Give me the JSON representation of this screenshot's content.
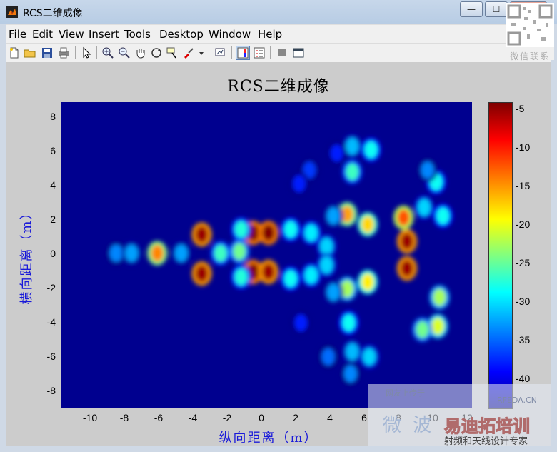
{
  "window": {
    "title": "RCS二维成像",
    "buttons": {
      "minimize": "—",
      "maximize": "☐",
      "close": "✕"
    }
  },
  "menu": [
    "File",
    "Edit",
    "View",
    "Insert",
    "Tools",
    "Desktop",
    "Window",
    "Help"
  ],
  "toolbar": {
    "icons": [
      "new-figure-icon",
      "open-icon",
      "save-icon",
      "print-icon",
      "select-arrow-icon",
      "zoom-in-icon",
      "zoom-out-icon",
      "pan-hand-icon",
      "rotate-3d-icon",
      "data-cursor-icon",
      "brush-icon",
      "link-plot-icon",
      "colorbar-icon",
      "legend-icon",
      "hide-tools-icon",
      "show-tools-icon"
    ]
  },
  "qr_caption": "微信联系",
  "chart_data": {
    "type": "heatmap",
    "title": "RCS二维成像",
    "xlabel": "纵向距离（m）",
    "ylabel": "横向距离（m）",
    "xlim": [
      -12,
      12
    ],
    "ylim": [
      -9,
      9
    ],
    "x_ticks": [
      "-10",
      "-8",
      "-6",
      "-4",
      "-2",
      "0",
      "2",
      "4",
      "6",
      "8",
      "10",
      "12"
    ],
    "y_ticks": [
      "8",
      "6",
      "4",
      "2",
      "0",
      "-2",
      "-4",
      "-6",
      "-8"
    ],
    "colorbar_ticks": [
      "-5",
      "-10",
      "-15",
      "-20",
      "-25",
      "-30",
      "-35",
      "-40"
    ],
    "colorbar_range": [
      -43,
      -4
    ],
    "colormap": "jet",
    "background_value": -43,
    "scatterers": [
      {
        "x": -3.8,
        "y": 1.2,
        "v": -5
      },
      {
        "x": -3.8,
        "y": -1.1,
        "v": -5
      },
      {
        "x": -0.8,
        "y": 1.3,
        "v": -4
      },
      {
        "x": 0.1,
        "y": 1.3,
        "v": -4
      },
      {
        "x": -0.8,
        "y": -1.0,
        "v": -4
      },
      {
        "x": 0.1,
        "y": -1.0,
        "v": -5
      },
      {
        "x": 8.2,
        "y": 0.8,
        "v": -5
      },
      {
        "x": 8.2,
        "y": -0.8,
        "v": -5
      },
      {
        "x": -6.4,
        "y": 0.1,
        "v": -14
      },
      {
        "x": 8.0,
        "y": 2.2,
        "v": -12
      },
      {
        "x": 4.7,
        "y": 2.4,
        "v": -15
      },
      {
        "x": 5.9,
        "y": 1.8,
        "v": -17
      },
      {
        "x": 5.9,
        "y": -1.6,
        "v": -18
      },
      {
        "x": 4.7,
        "y": -2.0,
        "v": -22
      },
      {
        "x": 10.0,
        "y": -4.2,
        "v": -20
      },
      {
        "x": 10.1,
        "y": -2.5,
        "v": -22
      },
      {
        "x": 9.1,
        "y": -4.4,
        "v": -24
      },
      {
        "x": -1.6,
        "y": 0.2,
        "v": -24
      },
      {
        "x": -2.7,
        "y": 0.1,
        "v": -26
      },
      {
        "x": -1.5,
        "y": 1.5,
        "v": -27
      },
      {
        "x": -1.5,
        "y": -1.3,
        "v": -27
      },
      {
        "x": 1.4,
        "y": 1.5,
        "v": -28
      },
      {
        "x": 1.4,
        "y": -1.4,
        "v": -28
      },
      {
        "x": 2.6,
        "y": 1.3,
        "v": -29
      },
      {
        "x": 2.6,
        "y": -1.2,
        "v": -29
      },
      {
        "x": 3.5,
        "y": 0.5,
        "v": -30
      },
      {
        "x": 3.5,
        "y": -0.6,
        "v": -30
      },
      {
        "x": 5.0,
        "y": 4.9,
        "v": -26
      },
      {
        "x": 6.1,
        "y": 6.2,
        "v": -28
      },
      {
        "x": 5.0,
        "y": 6.4,
        "v": -31
      },
      {
        "x": 9.9,
        "y": 4.3,
        "v": -28
      },
      {
        "x": 10.3,
        "y": 2.3,
        "v": -28
      },
      {
        "x": 9.2,
        "y": 2.8,
        "v": -30
      },
      {
        "x": 4.8,
        "y": -4.0,
        "v": -28
      },
      {
        "x": 5.0,
        "y": -5.7,
        "v": -31
      },
      {
        "x": 6.0,
        "y": -6.0,
        "v": -30
      },
      {
        "x": 4.9,
        "y": -7.0,
        "v": -33
      },
      {
        "x": 3.6,
        "y": -6.0,
        "v": -34
      },
      {
        "x": 2.5,
        "y": 5.0,
        "v": -36
      },
      {
        "x": 4.1,
        "y": 6.0,
        "v": -37
      },
      {
        "x": -8.8,
        "y": 0.1,
        "v": -33
      },
      {
        "x": -7.9,
        "y": 0.1,
        "v": -32
      },
      {
        "x": -5.0,
        "y": 0.1,
        "v": -32
      },
      {
        "x": 1.9,
        "y": 4.2,
        "v": -37
      },
      {
        "x": 2.0,
        "y": -4.0,
        "v": -37
      },
      {
        "x": 9.4,
        "y": 5.0,
        "v": -33
      },
      {
        "x": 3.9,
        "y": 2.3,
        "v": -32
      },
      {
        "x": 3.9,
        "y": -2.2,
        "v": -32
      }
    ]
  },
  "watermark": {
    "line1": "网友上传于",
    "line2": "RFEDA.CN",
    "line3": "微 波",
    "line4": "易迪拓培训",
    "line5": "射频和天线设计专家"
  }
}
